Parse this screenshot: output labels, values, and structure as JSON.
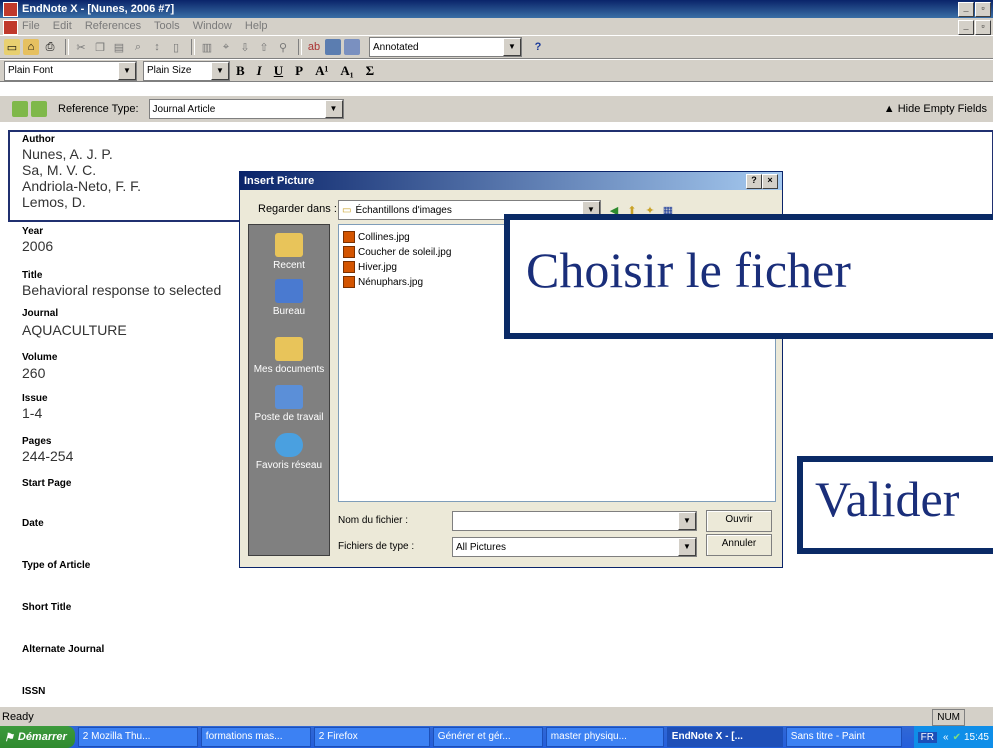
{
  "window": {
    "title": "EndNote X - [Nunes, 2006 #7]"
  },
  "menu": {
    "items": [
      "File",
      "Edit",
      "References",
      "Tools",
      "Window",
      "Help"
    ]
  },
  "toolbar": {
    "style_value": "Annotated",
    "help_label": "?"
  },
  "format": {
    "font_value": "Plain Font",
    "size_value": "Plain Size",
    "bold": "B",
    "italic": "I",
    "underline": "U",
    "plain": "P",
    "superscript": "A¹",
    "subscript": "A₁",
    "symbol": "Σ"
  },
  "reference": {
    "type_label": "Reference Type:",
    "type_value": "Journal Article",
    "hide_empty": "Hide Empty Fields"
  },
  "fields": {
    "author_label": "Author",
    "authors": [
      "Nunes, A. J. P.",
      "Sa, M. V. C.",
      "Andriola-Neto, F. F.",
      "Lemos, D."
    ],
    "year_label": "Year",
    "year": "2006",
    "title_label": "Title",
    "title": "Behavioral response to selected",
    "journal_label": "Journal",
    "journal": "AQUACULTURE",
    "volume_label": "Volume",
    "volume": "260",
    "issue_label": "Issue",
    "issue": "1-4",
    "pages_label": "Pages",
    "pages": "244-254",
    "start_page_label": "Start Page",
    "date_label": "Date",
    "type_of_article_label": "Type of Article",
    "short_title_label": "Short Title",
    "alternate_journal_label": "Alternate Journal",
    "issn_label": "ISSN"
  },
  "dialog": {
    "title": "Insert Picture",
    "help": "?",
    "close": "×",
    "look_in_label": "Regarder dans :",
    "look_in_value": "Échantillons d'images",
    "places": [
      "Recent",
      "Bureau",
      "Mes documents",
      "Poste de travail",
      "Favoris réseau"
    ],
    "files": [
      "Collines.jpg",
      "Coucher de soleil.jpg",
      "Hiver.jpg",
      "Nénuphars.jpg"
    ],
    "filename_label": "Nom du fichier :",
    "filename_value": "",
    "filetype_label": "Fichiers de type :",
    "filetype_value": "All Pictures",
    "open_button": "Ouvrir",
    "cancel_button": "Annuler"
  },
  "callouts": {
    "choose": "Choisir le ficher",
    "validate": "Valider"
  },
  "status": {
    "text": "Ready",
    "num": "NUM"
  },
  "taskbar": {
    "start": "Démarrer",
    "tasks": [
      "2 Mozilla Thu...",
      "formations mas...",
      "2 Firefox",
      "Générer et gér...",
      "master physiqu...",
      "EndNote X - [...",
      "Sans titre - Paint"
    ],
    "lang": "FR",
    "time": "15:45"
  },
  "colors": {
    "title_blue": "#0a246a",
    "callout_border": "#0a2a66",
    "callout_text": "#1a2e7a"
  }
}
